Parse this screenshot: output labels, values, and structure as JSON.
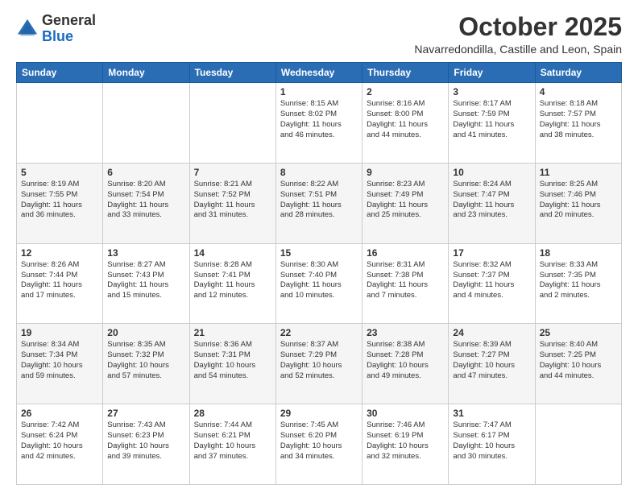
{
  "logo": {
    "general": "General",
    "blue": "Blue"
  },
  "header": {
    "month": "October 2025",
    "location": "Navarredondilla, Castille and Leon, Spain"
  },
  "days_of_week": [
    "Sunday",
    "Monday",
    "Tuesday",
    "Wednesday",
    "Thursday",
    "Friday",
    "Saturday"
  ],
  "weeks": [
    [
      {
        "day": "",
        "info": ""
      },
      {
        "day": "",
        "info": ""
      },
      {
        "day": "",
        "info": ""
      },
      {
        "day": "1",
        "info": "Sunrise: 8:15 AM\nSunset: 8:02 PM\nDaylight: 11 hours\nand 46 minutes."
      },
      {
        "day": "2",
        "info": "Sunrise: 8:16 AM\nSunset: 8:00 PM\nDaylight: 11 hours\nand 44 minutes."
      },
      {
        "day": "3",
        "info": "Sunrise: 8:17 AM\nSunset: 7:59 PM\nDaylight: 11 hours\nand 41 minutes."
      },
      {
        "day": "4",
        "info": "Sunrise: 8:18 AM\nSunset: 7:57 PM\nDaylight: 11 hours\nand 38 minutes."
      }
    ],
    [
      {
        "day": "5",
        "info": "Sunrise: 8:19 AM\nSunset: 7:55 PM\nDaylight: 11 hours\nand 36 minutes."
      },
      {
        "day": "6",
        "info": "Sunrise: 8:20 AM\nSunset: 7:54 PM\nDaylight: 11 hours\nand 33 minutes."
      },
      {
        "day": "7",
        "info": "Sunrise: 8:21 AM\nSunset: 7:52 PM\nDaylight: 11 hours\nand 31 minutes."
      },
      {
        "day": "8",
        "info": "Sunrise: 8:22 AM\nSunset: 7:51 PM\nDaylight: 11 hours\nand 28 minutes."
      },
      {
        "day": "9",
        "info": "Sunrise: 8:23 AM\nSunset: 7:49 PM\nDaylight: 11 hours\nand 25 minutes."
      },
      {
        "day": "10",
        "info": "Sunrise: 8:24 AM\nSunset: 7:47 PM\nDaylight: 11 hours\nand 23 minutes."
      },
      {
        "day": "11",
        "info": "Sunrise: 8:25 AM\nSunset: 7:46 PM\nDaylight: 11 hours\nand 20 minutes."
      }
    ],
    [
      {
        "day": "12",
        "info": "Sunrise: 8:26 AM\nSunset: 7:44 PM\nDaylight: 11 hours\nand 17 minutes."
      },
      {
        "day": "13",
        "info": "Sunrise: 8:27 AM\nSunset: 7:43 PM\nDaylight: 11 hours\nand 15 minutes."
      },
      {
        "day": "14",
        "info": "Sunrise: 8:28 AM\nSunset: 7:41 PM\nDaylight: 11 hours\nand 12 minutes."
      },
      {
        "day": "15",
        "info": "Sunrise: 8:30 AM\nSunset: 7:40 PM\nDaylight: 11 hours\nand 10 minutes."
      },
      {
        "day": "16",
        "info": "Sunrise: 8:31 AM\nSunset: 7:38 PM\nDaylight: 11 hours\nand 7 minutes."
      },
      {
        "day": "17",
        "info": "Sunrise: 8:32 AM\nSunset: 7:37 PM\nDaylight: 11 hours\nand 4 minutes."
      },
      {
        "day": "18",
        "info": "Sunrise: 8:33 AM\nSunset: 7:35 PM\nDaylight: 11 hours\nand 2 minutes."
      }
    ],
    [
      {
        "day": "19",
        "info": "Sunrise: 8:34 AM\nSunset: 7:34 PM\nDaylight: 10 hours\nand 59 minutes."
      },
      {
        "day": "20",
        "info": "Sunrise: 8:35 AM\nSunset: 7:32 PM\nDaylight: 10 hours\nand 57 minutes."
      },
      {
        "day": "21",
        "info": "Sunrise: 8:36 AM\nSunset: 7:31 PM\nDaylight: 10 hours\nand 54 minutes."
      },
      {
        "day": "22",
        "info": "Sunrise: 8:37 AM\nSunset: 7:29 PM\nDaylight: 10 hours\nand 52 minutes."
      },
      {
        "day": "23",
        "info": "Sunrise: 8:38 AM\nSunset: 7:28 PM\nDaylight: 10 hours\nand 49 minutes."
      },
      {
        "day": "24",
        "info": "Sunrise: 8:39 AM\nSunset: 7:27 PM\nDaylight: 10 hours\nand 47 minutes."
      },
      {
        "day": "25",
        "info": "Sunrise: 8:40 AM\nSunset: 7:25 PM\nDaylight: 10 hours\nand 44 minutes."
      }
    ],
    [
      {
        "day": "26",
        "info": "Sunrise: 7:42 AM\nSunset: 6:24 PM\nDaylight: 10 hours\nand 42 minutes."
      },
      {
        "day": "27",
        "info": "Sunrise: 7:43 AM\nSunset: 6:23 PM\nDaylight: 10 hours\nand 39 minutes."
      },
      {
        "day": "28",
        "info": "Sunrise: 7:44 AM\nSunset: 6:21 PM\nDaylight: 10 hours\nand 37 minutes."
      },
      {
        "day": "29",
        "info": "Sunrise: 7:45 AM\nSunset: 6:20 PM\nDaylight: 10 hours\nand 34 minutes."
      },
      {
        "day": "30",
        "info": "Sunrise: 7:46 AM\nSunset: 6:19 PM\nDaylight: 10 hours\nand 32 minutes."
      },
      {
        "day": "31",
        "info": "Sunrise: 7:47 AM\nSunset: 6:17 PM\nDaylight: 10 hours\nand 30 minutes."
      },
      {
        "day": "",
        "info": ""
      }
    ]
  ]
}
